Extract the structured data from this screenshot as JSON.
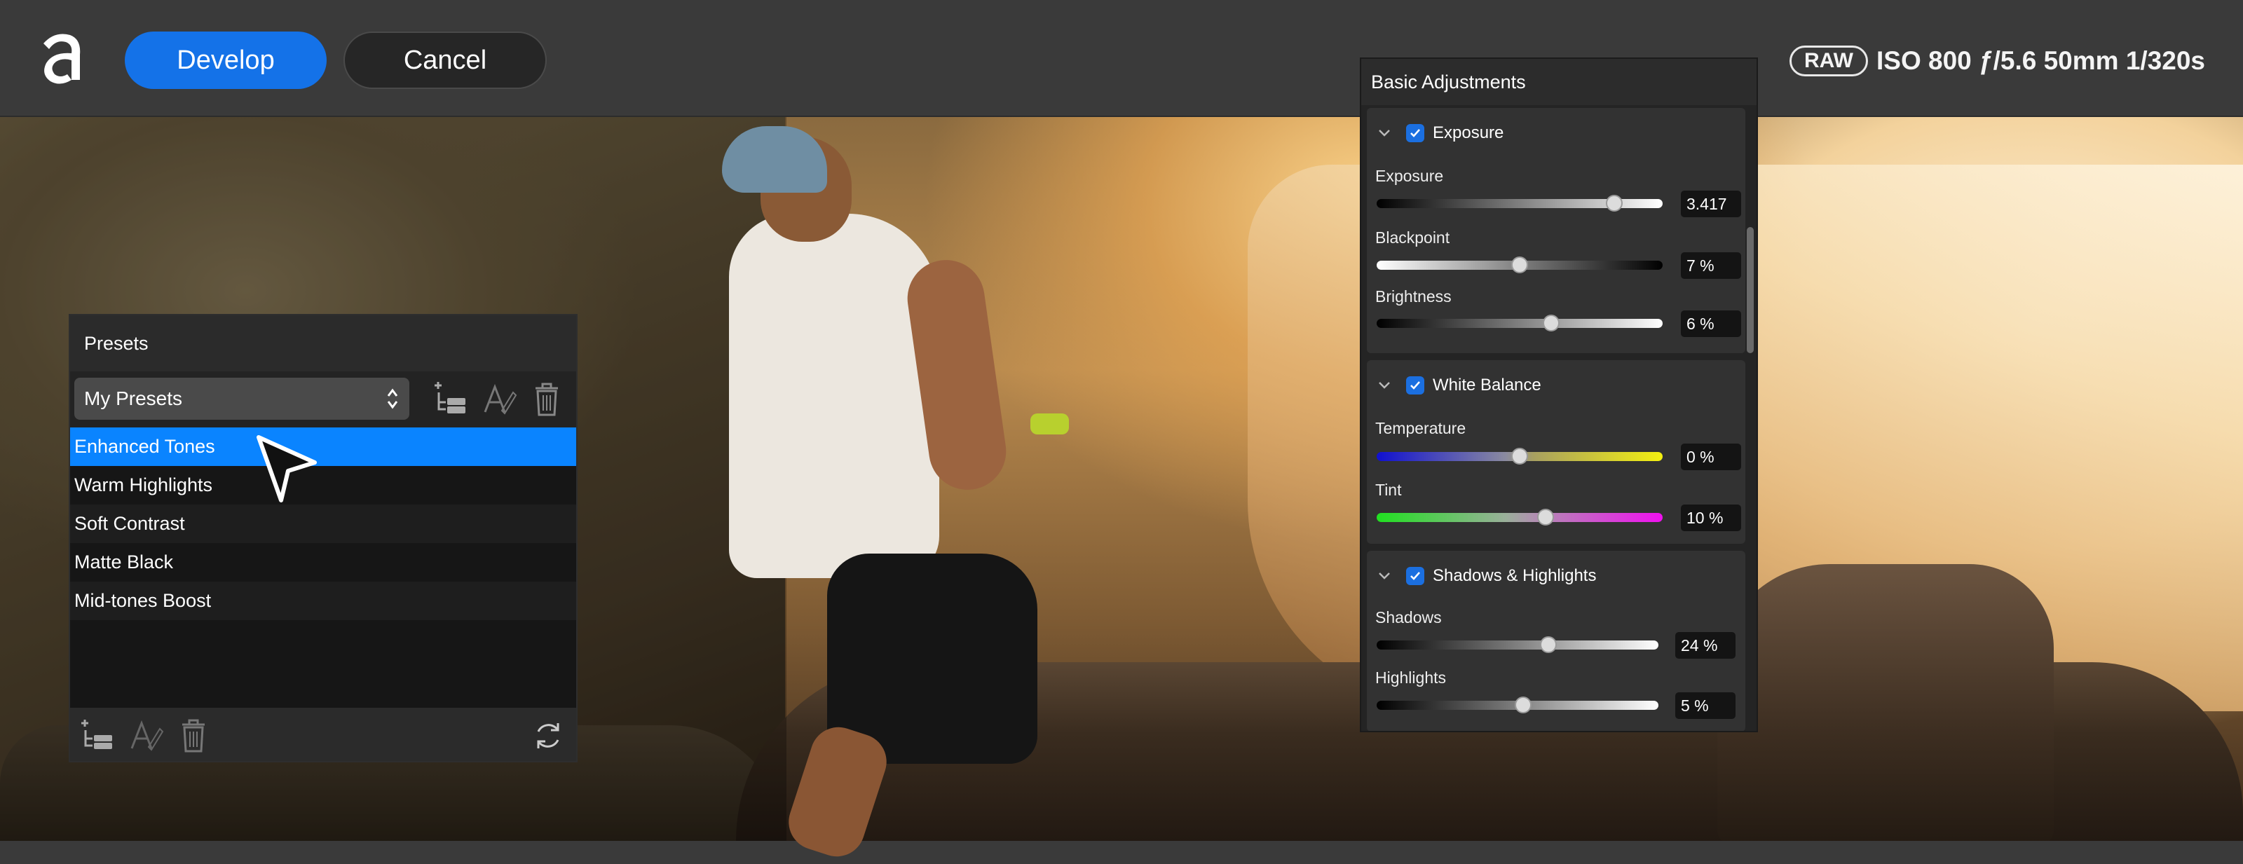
{
  "app": {
    "develop_label": "Develop",
    "cancel_label": "Cancel"
  },
  "exif": {
    "badge": "RAW",
    "text": "ISO 800 ƒ/5.6 50mm 1/320s"
  },
  "presets": {
    "title": "Presets",
    "selected_group": "My Presets",
    "items": [
      {
        "label": "Enhanced Tones",
        "selected": true
      },
      {
        "label": "Warm Highlights",
        "selected": false
      },
      {
        "label": "Soft Contrast",
        "selected": false
      },
      {
        "label": "Matte Black",
        "selected": false
      },
      {
        "label": "Mid-tones Boost",
        "selected": false
      }
    ]
  },
  "adjustments": {
    "title": "Basic Adjustments",
    "sections": [
      {
        "name": "Exposure",
        "checked": true,
        "controls": [
          {
            "label": "Exposure",
            "value": "3.417",
            "position": 0.83
          },
          {
            "label": "Blackpoint",
            "value": "7 %",
            "position": 0.5
          },
          {
            "label": "Brightness",
            "value": "6 %",
            "position": 0.61
          }
        ]
      },
      {
        "name": "White Balance",
        "checked": true,
        "controls": [
          {
            "label": "Temperature",
            "value": "0 %",
            "position": 0.5
          },
          {
            "label": "Tint",
            "value": "10 %",
            "position": 0.59
          }
        ]
      },
      {
        "name": "Shadows & Highlights",
        "checked": true,
        "controls": [
          {
            "label": "Shadows",
            "value": "24 %",
            "position": 0.61
          },
          {
            "label": "Highlights",
            "value": "5 %",
            "position": 0.52
          }
        ]
      }
    ]
  },
  "colors": {
    "accent": "#1472e8",
    "selection": "#0a84ff",
    "wrist_band": "#b8d02e"
  }
}
